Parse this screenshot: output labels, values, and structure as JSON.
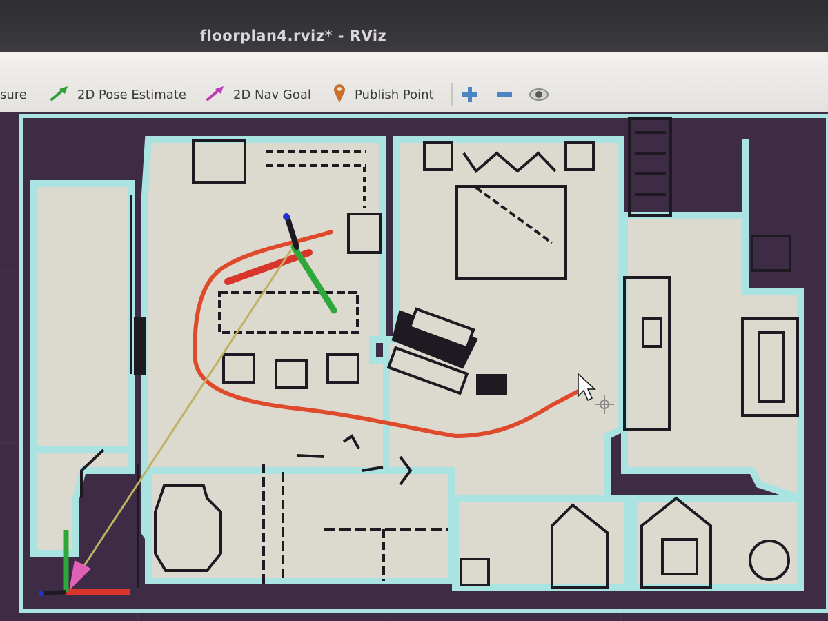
{
  "window": {
    "title": "floorplan4.rviz* - RViz"
  },
  "toolbar": {
    "tools": [
      {
        "id": "measure",
        "label": "sure",
        "icon": "ruler-icon"
      },
      {
        "id": "pose_estimate",
        "label": "2D Pose Estimate",
        "icon": "green-arrow-icon",
        "color": "#2e9e3a"
      },
      {
        "id": "nav_goal",
        "label": "2D Nav Goal",
        "icon": "pink-arrow-icon",
        "color": "#c13ab5"
      },
      {
        "id": "publish_point",
        "label": "Publish Point",
        "icon": "map-pin-icon",
        "color": "#c8702e"
      }
    ],
    "actions": [
      {
        "id": "add",
        "icon": "plus-icon"
      },
      {
        "id": "remove",
        "icon": "minus-icon"
      },
      {
        "id": "camera",
        "icon": "eye-icon"
      }
    ]
  },
  "viewport": {
    "map_colors": {
      "unknown": "#3e2b45",
      "free": "#dcd9cf",
      "inflation": "#a9e3e2",
      "obstacle": "#1e1a22"
    },
    "path_color": "#e04a2c",
    "goal_arrow_color": "#e060b5",
    "origin_axes": {
      "x": "#d8362a",
      "y": "#2ea83a",
      "z": "#2233cc"
    }
  }
}
